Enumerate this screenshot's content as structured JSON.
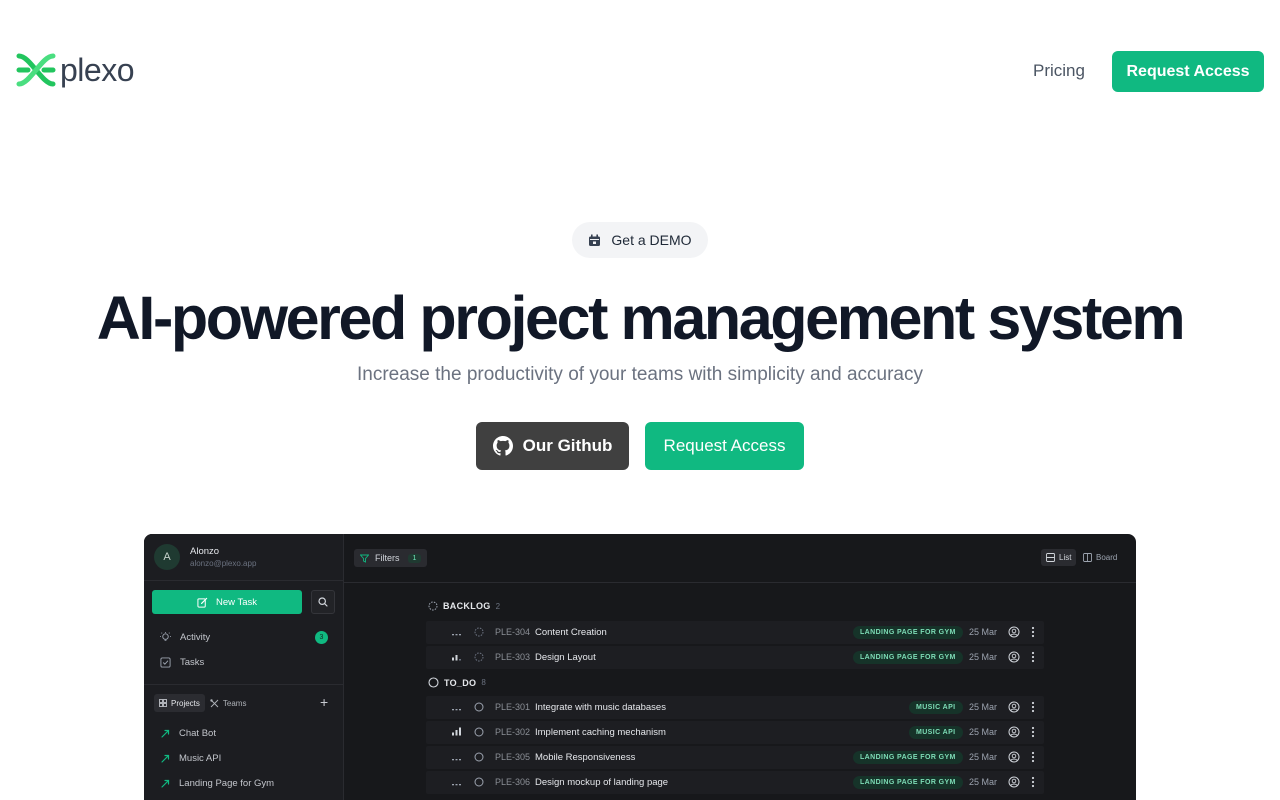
{
  "brand": {
    "name": "plexo"
  },
  "nav": {
    "pricing": "Pricing",
    "request_access": "Request Access"
  },
  "hero": {
    "pill": "Get a DEMO",
    "title": "AI-powered project management system",
    "subtitle": "Increase the productivity of your teams with simplicity and accuracy",
    "github_button": "Our Github",
    "request_button": "Request Access"
  },
  "app": {
    "user": {
      "initial": "A",
      "name": "Alonzo",
      "email": "alonzo@plexo.app"
    },
    "new_task": "New Task",
    "links": {
      "activity": "Activity",
      "activity_badge": "3",
      "tasks": "Tasks"
    },
    "segment": {
      "projects": "Projects",
      "teams": "Teams"
    },
    "plus": "+",
    "projects": [
      "Chat Bot",
      "Music API",
      "Landing Page for Gym"
    ],
    "filters": {
      "label": "Filters",
      "count": "1"
    },
    "views": {
      "list": "List",
      "board": "Board"
    },
    "groups": [
      {
        "name": "BACKLOG",
        "count": "2"
      },
      {
        "name": "TO_DO",
        "count": "8"
      }
    ],
    "tasks": [
      {
        "id": "PLE-304",
        "title": "Content Creation",
        "tag": "LANDING PAGE FOR GYM",
        "date": "25 Mar"
      },
      {
        "id": "PLE-303",
        "title": "Design Layout",
        "tag": "LANDING PAGE FOR GYM",
        "date": "25 Mar"
      },
      {
        "id": "PLE-301",
        "title": "Integrate with music databases",
        "tag": "MUSIC API",
        "date": "25 Mar"
      },
      {
        "id": "PLE-302",
        "title": "Implement caching mechanism",
        "tag": "MUSIC API",
        "date": "25 Mar"
      },
      {
        "id": "PLE-305",
        "title": "Mobile Responsiveness",
        "tag": "LANDING PAGE FOR GYM",
        "date": "25 Mar"
      },
      {
        "id": "PLE-306",
        "title": "Design mockup of landing page",
        "tag": "LANDING PAGE FOR GYM",
        "date": "25 Mar"
      }
    ]
  },
  "colors": {
    "accent": "#10b981",
    "dark_button": "#404040",
    "text": "#111827",
    "muted": "#6b7280"
  }
}
